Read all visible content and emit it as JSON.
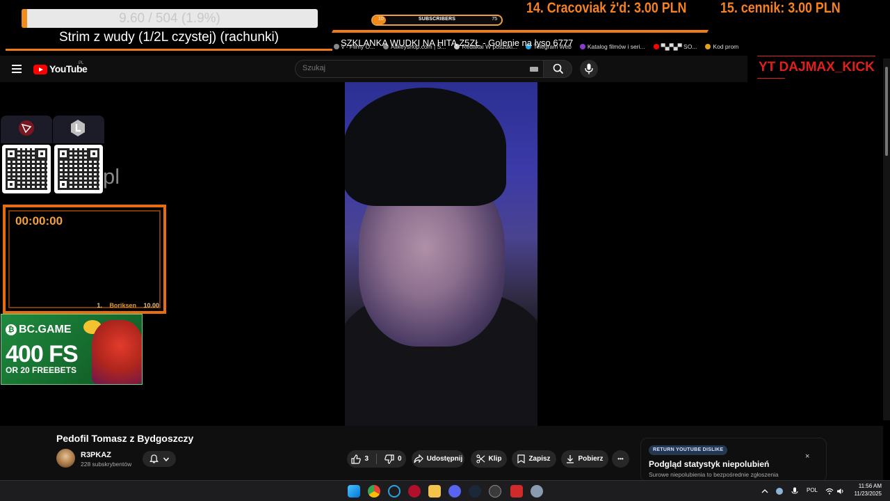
{
  "overlay": {
    "goal_text": "9.60 / 504 (1.9%)",
    "goal_fraction": 0.019,
    "stream_title": "Strim z wudy (1/2L czystej) (rachunki)",
    "subscribers": {
      "label": "SUBSCRIBERS",
      "min": "10",
      "max": "75",
      "fraction": 0.1
    },
    "ticker_1": "14. Cracoviak ż'd: 3.00 PLN",
    "ticker_2": "15. cennik: 3.00 PLN",
    "tts_message": "SZKLANKA WUDKI NA HITA Z5ZŁ - Golenie na łyso 6777",
    "kick_label": "YT DAJMAX_KICK",
    "pl_text": "pl",
    "timer": "00:00:00",
    "top_donor": {
      "rank": "1.",
      "name": "Boriksen",
      "amount": "10.00"
    },
    "ad": {
      "logo": "BC.GAME",
      "offer": "400 FS",
      "sub_offer": "OR 20 FREEBETS"
    }
  },
  "bookmarks": [
    {
      "label": "v - Filmy O...",
      "color": "#888888"
    },
    {
      "label": "Allkeyshop.com | S...",
      "color": "#888888"
    },
    {
      "label": "Redakai W poszuki...",
      "color": "#cccccc"
    },
    {
      "label": "Telegram Web",
      "color": "#2aa3e0"
    },
    {
      "label": "Katalog filmów i seri...",
      "color": "#8a3bd1"
    },
    {
      "label": "▀▄▀▄▀ SO...",
      "color": "#ff0000"
    },
    {
      "label": "Kod prom",
      "color": "#e0a020"
    }
  ],
  "youtube": {
    "logo_text": "YouTube",
    "country": "PL",
    "search_placeholder": "Szukaj",
    "video_title": "Pedofil Tomasz z Bydgoszczy",
    "channel_name": "R3PKAZ",
    "channel_subs": "228 subskrybentów",
    "likes": "3",
    "dislikes": "0",
    "share_label": "Udostępnij",
    "clip_label": "Klip",
    "save_label": "Zapisz",
    "download_label": "Pobierz",
    "more_label": "•••"
  },
  "return_dislike": {
    "badge": "RETURN YOUTUBE DISLIKE",
    "title": "Podgląd statystyk niepolubień",
    "subtitle": "Surowe niepolubienia to bezpośrednie zgłoszenia",
    "close": "×"
  },
  "taskbar": {
    "language": "POL",
    "time": "11:56 AM",
    "date": "11/23/2025"
  }
}
